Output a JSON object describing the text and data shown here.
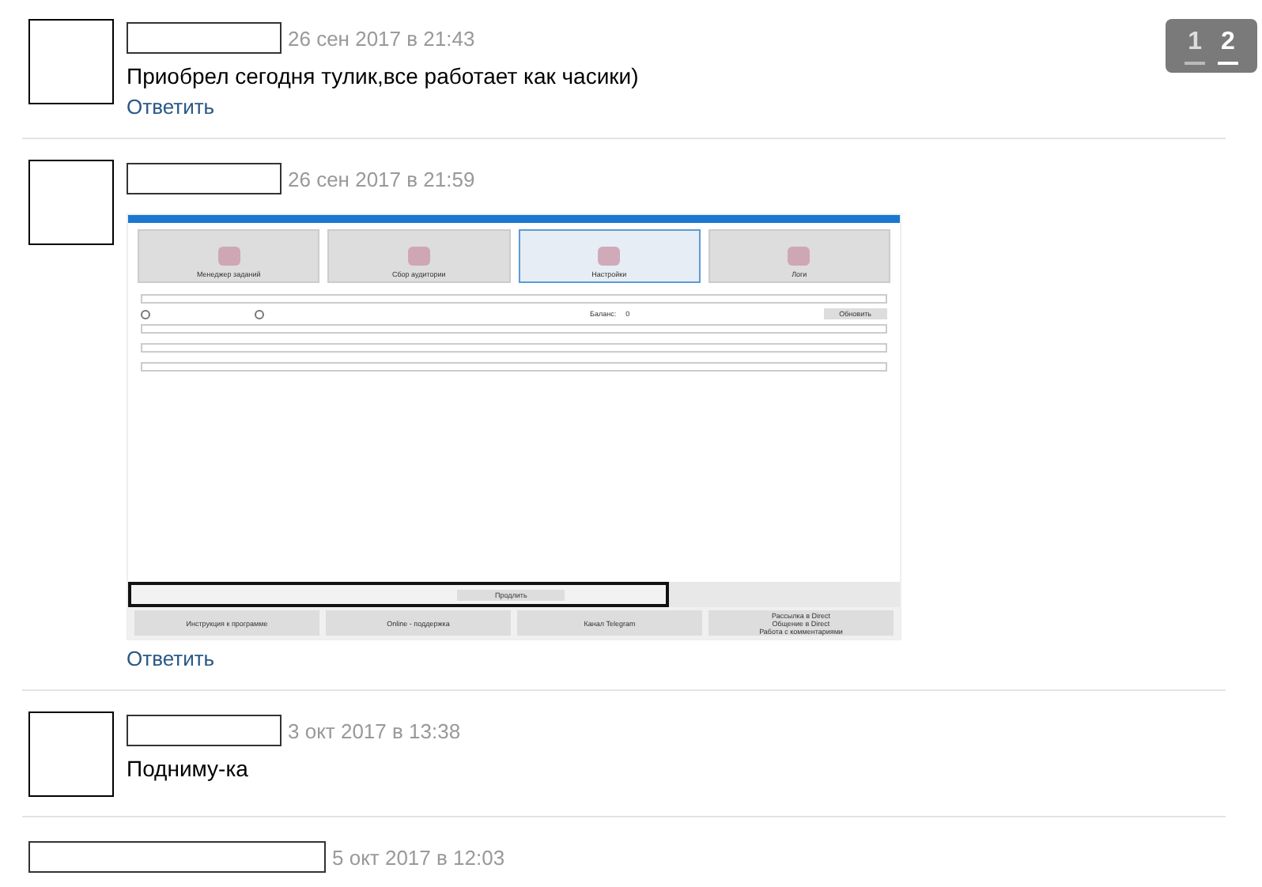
{
  "pager": {
    "pages": [
      {
        "label": "1",
        "selected": false
      },
      {
        "label": "2",
        "selected": true
      }
    ]
  },
  "comments": [
    {
      "avatar": true,
      "date": "26 сен 2017 в 21:43",
      "text": "Приобрел сегодня тулик,все работает как часики)",
      "reply": "Ответить"
    },
    {
      "avatar": true,
      "date": "26 сен 2017 в 21:59",
      "attachment": {
        "tiles": [
          {
            "label": "Менеджер заданий",
            "selected": false
          },
          {
            "label": "Сбор аудитории",
            "selected": false
          },
          {
            "label": "Настройки",
            "selected": true
          },
          {
            "label": "Логи",
            "selected": false
          }
        ],
        "balance_label": "Баланс:",
        "balance_value": "0",
        "refresh_button": "Обновить",
        "extend_button": "Продлить",
        "bottom_buttons": [
          {
            "lines": [
              "Инструкция к программе"
            ]
          },
          {
            "lines": [
              "Online - поддержка"
            ]
          },
          {
            "lines": [
              "Канал Telegram"
            ]
          },
          {
            "lines": [
              "Рассылка в Direct",
              "Общение в Direct",
              "Работа с комментариями"
            ]
          }
        ]
      },
      "reply": "Ответить"
    },
    {
      "avatar": true,
      "date": "3 окт 2017 в 13:38",
      "text": "Подниму-ка"
    },
    {
      "avatar": false,
      "date": "5 окт 2017 в 12:03"
    }
  ]
}
